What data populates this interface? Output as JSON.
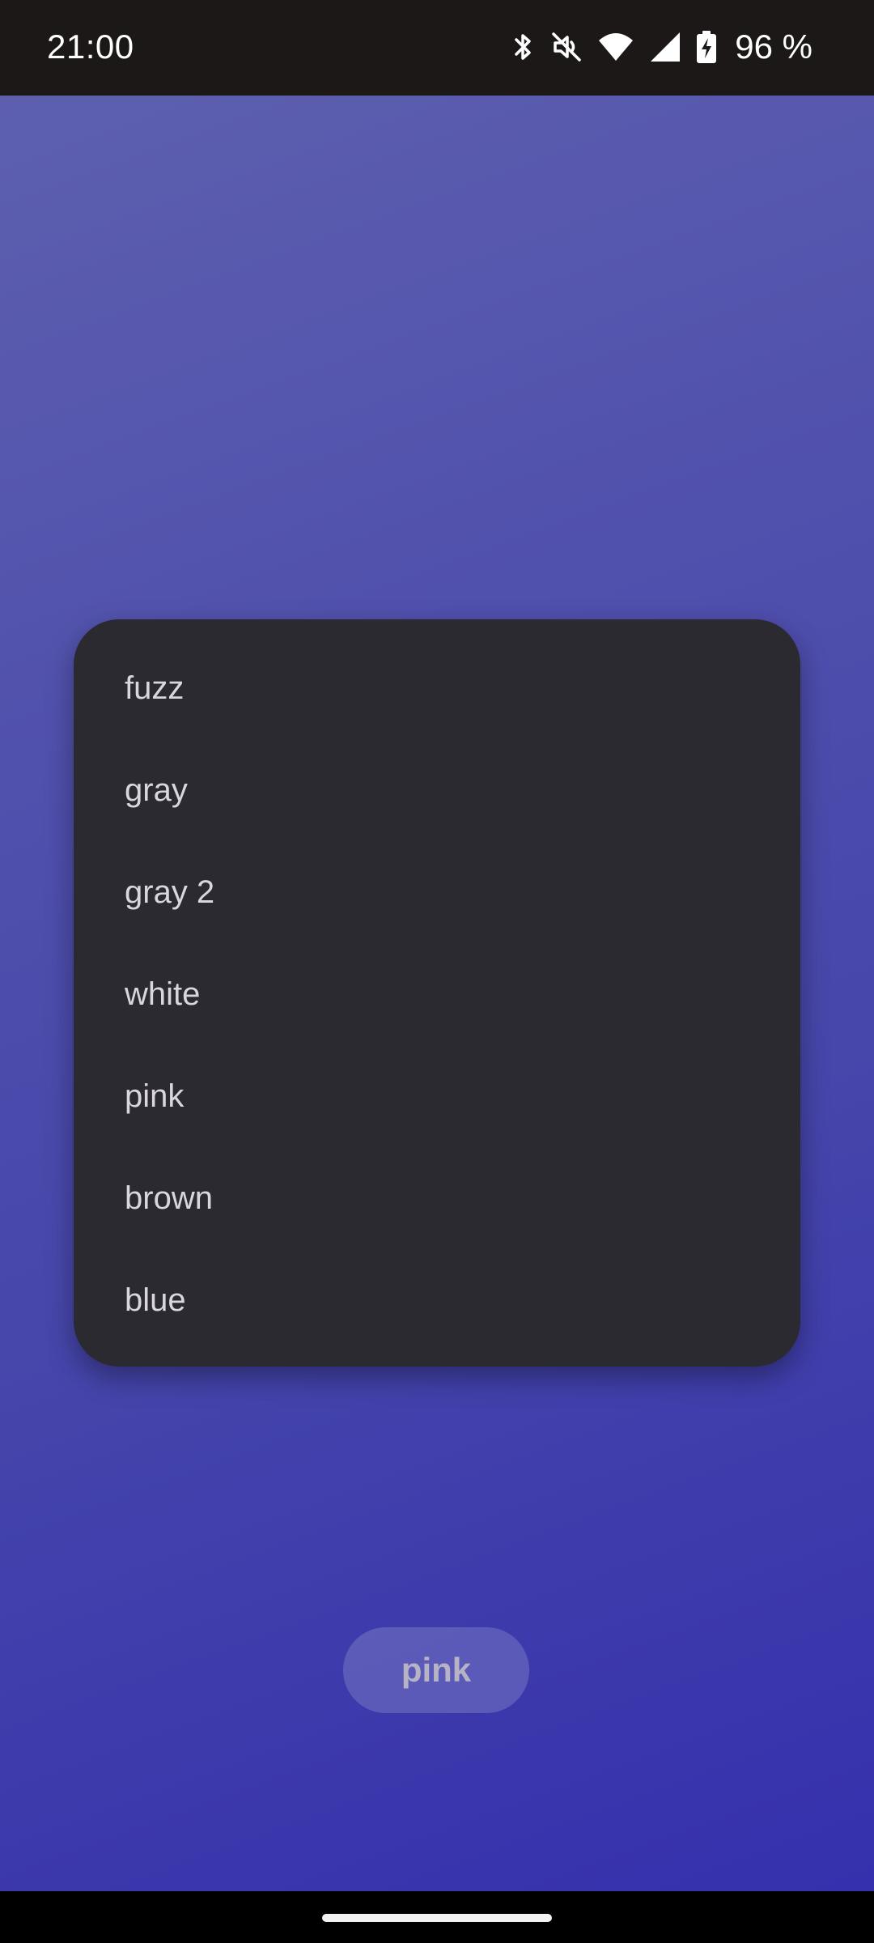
{
  "status_bar": {
    "time": "21:00",
    "battery": "96 %",
    "icons": [
      "bluetooth-icon",
      "mute-icon",
      "wifi-icon",
      "cell-signal-icon",
      "battery-charging-icon"
    ]
  },
  "menu": {
    "items": [
      {
        "label": "fuzz"
      },
      {
        "label": "gray"
      },
      {
        "label": "gray 2"
      },
      {
        "label": "white"
      },
      {
        "label": "pink"
      },
      {
        "label": "brown"
      },
      {
        "label": "blue"
      }
    ]
  },
  "button": {
    "label": "pink"
  },
  "colors": {
    "background_top": "#5d5fae",
    "background_bottom": "#3530ad",
    "menu_surface": "#2b2a30",
    "menu_text": "#d9d6dd"
  }
}
